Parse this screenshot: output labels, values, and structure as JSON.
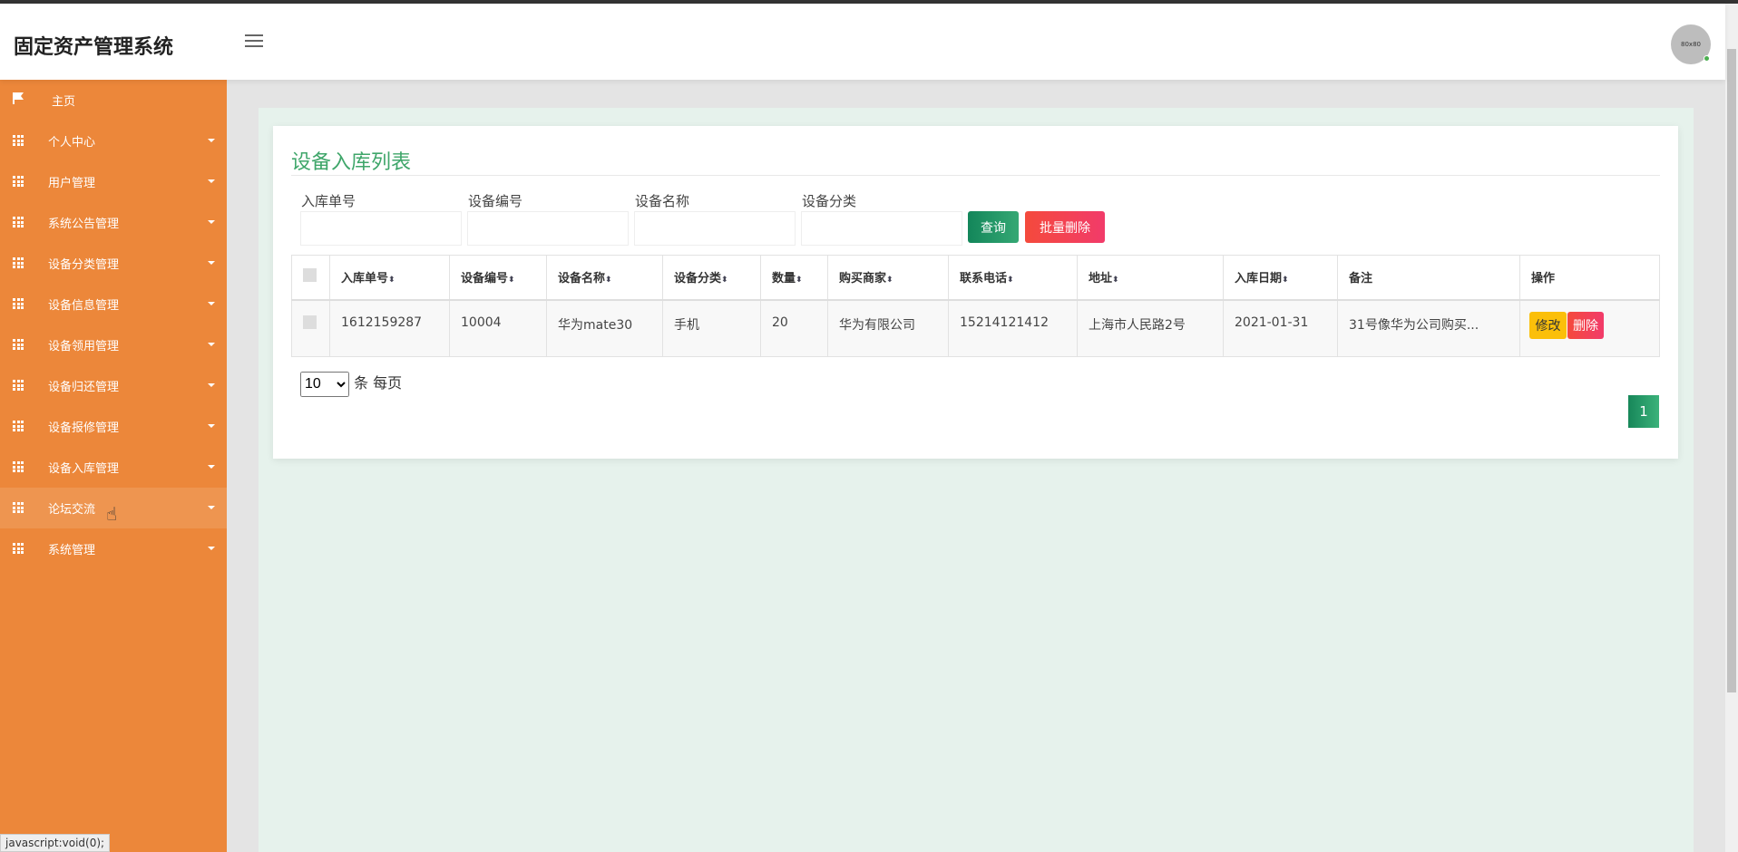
{
  "app": {
    "title": "固定资产管理系统",
    "avatar_text": "80x80"
  },
  "sidebar": {
    "items": [
      {
        "label": "主页",
        "icon": "flag-icon"
      },
      {
        "label": "个人中心",
        "icon": "grid-icon"
      },
      {
        "label": "用户管理",
        "icon": "grid-icon"
      },
      {
        "label": "系统公告管理",
        "icon": "grid-icon"
      },
      {
        "label": "设备分类管理",
        "icon": "grid-icon"
      },
      {
        "label": "设备信息管理",
        "icon": "grid-icon"
      },
      {
        "label": "设备领用管理",
        "icon": "grid-icon"
      },
      {
        "label": "设备归还管理",
        "icon": "grid-icon"
      },
      {
        "label": "设备报修管理",
        "icon": "grid-icon"
      },
      {
        "label": "设备入库管理",
        "icon": "grid-icon"
      },
      {
        "label": "论坛交流",
        "icon": "grid-icon"
      },
      {
        "label": "系统管理",
        "icon": "grid-icon"
      }
    ]
  },
  "main": {
    "title": "设备入库列表",
    "filters": [
      {
        "label": "入库单号",
        "value": ""
      },
      {
        "label": "设备编号",
        "value": ""
      },
      {
        "label": "设备名称",
        "value": ""
      },
      {
        "label": "设备分类",
        "value": ""
      }
    ],
    "search_label": "查询",
    "batch_delete_label": "批量删除",
    "columns": [
      "入库单号",
      "设备编号",
      "设备名称",
      "设备分类",
      "数量",
      "购买商家",
      "联系电话",
      "地址",
      "入库日期",
      "备注",
      "操作"
    ],
    "rows": [
      [
        "1612159287",
        "10004",
        "华为mate30",
        "手机",
        "20",
        "华为有限公司",
        "15214121412",
        "上海市人民路2号",
        "2021-01-31",
        "31号像华为公司购买..."
      ]
    ],
    "edit_label": "修改",
    "delete_label": "删除",
    "page_size": "10",
    "page_size_suffix": "条 每页",
    "current_page": "1"
  },
  "colors": {
    "sidebar": "#ec873a",
    "accent": "#3fa66a",
    "edit": "#fbbf0a",
    "delete": "#f0455a"
  },
  "status_bar": "javascript:void(0);"
}
